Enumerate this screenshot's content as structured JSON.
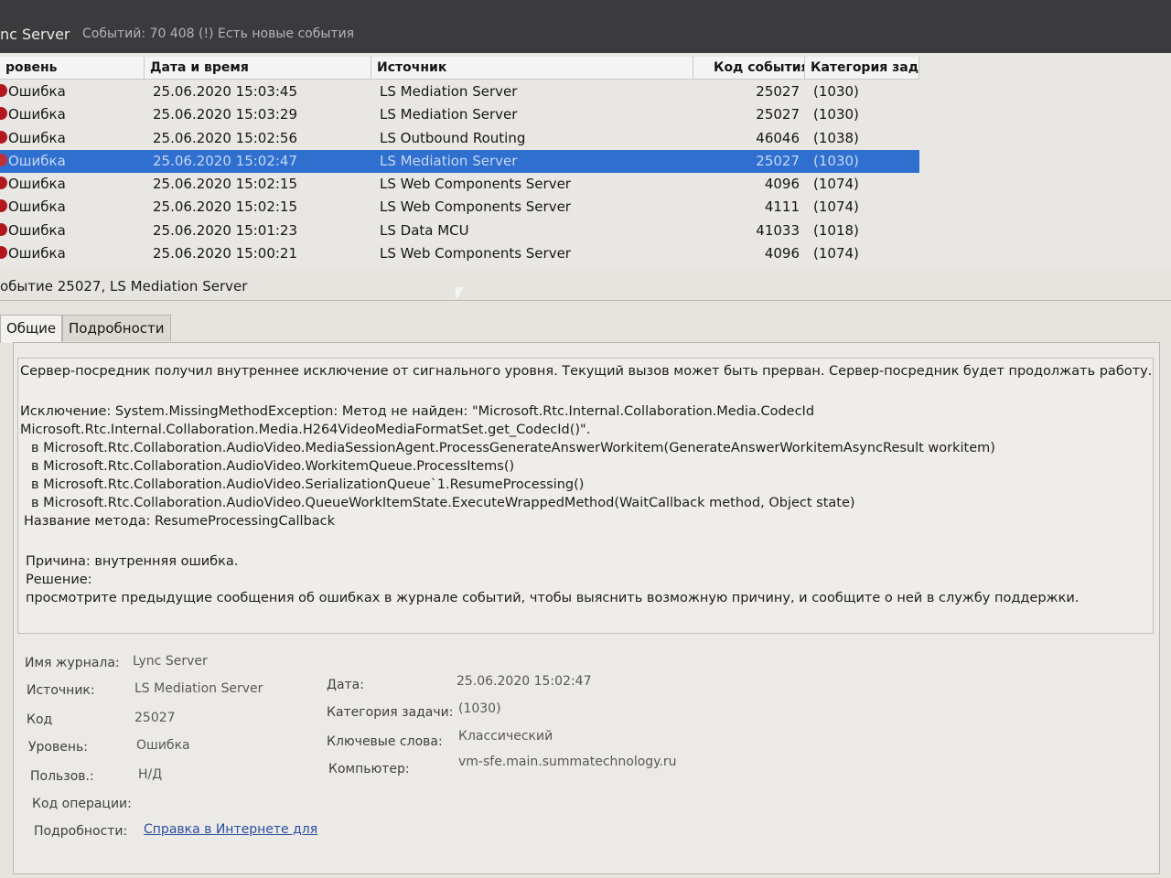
{
  "window": {
    "title": "nc Server",
    "status": "Событий: 70 408 (!) Есть новые события"
  },
  "columns": [
    "ровень",
    "Дата и время",
    "Источник",
    "Код события",
    "Категория зад..."
  ],
  "events": [
    {
      "level": "Ошибка",
      "datetime": "25.06.2020 15:03:45",
      "source": "LS Mediation Server",
      "code": "25027",
      "category": "(1030)",
      "selected": false
    },
    {
      "level": "Ошибка",
      "datetime": "25.06.2020 15:03:29",
      "source": "LS Mediation Server",
      "code": "25027",
      "category": "(1030)",
      "selected": false
    },
    {
      "level": "Ошибка",
      "datetime": "25.06.2020 15:02:56",
      "source": "LS Outbound Routing",
      "code": "46046",
      "category": "(1038)",
      "selected": false
    },
    {
      "level": "Ошибка",
      "datetime": "25.06.2020 15:02:47",
      "source": "LS Mediation Server",
      "code": "25027",
      "category": "(1030)",
      "selected": true
    },
    {
      "level": "Ошибка",
      "datetime": "25.06.2020 15:02:15",
      "source": "LS Web Components Server",
      "code": "4096",
      "category": "(1074)",
      "selected": false
    },
    {
      "level": "Ошибка",
      "datetime": "25.06.2020 15:02:15",
      "source": "LS Web Components Server",
      "code": "4111",
      "category": "(1074)",
      "selected": false
    },
    {
      "level": "Ошибка",
      "datetime": "25.06.2020 15:01:23",
      "source": "LS Data MCU",
      "code": "41033",
      "category": "(1018)",
      "selected": false
    },
    {
      "level": "Ошибка",
      "datetime": "25.06.2020 15:00:21",
      "source": "LS Web Components Server",
      "code": "4096",
      "category": "(1074)",
      "selected": false
    }
  ],
  "detail": {
    "title": "обытие 25027, LS Mediation Server",
    "tabs": [
      "Общие",
      "Подробности"
    ],
    "message": [
      "Сервер-посредник получил внутреннее исключение от сигнального уровня. Текущий вызов может быть прерван. Сервер-посредник будет продолжать работу.",
      "",
      "Исключение: System.MissingMethodException: Метод не найден: \"Microsoft.Rtc.Internal.Collaboration.Media.CodecId",
      "Microsoft.Rtc.Internal.Collaboration.Media.H264VideoMediaFormatSet.get_CodecId()\".",
      "  в Microsoft.Rtc.Collaboration.AudioVideo.MediaSessionAgent.ProcessGenerateAnswerWorkitem(GenerateAnswerWorkitemAsyncResult workitem)",
      "  в Microsoft.Rtc.Collaboration.AudioVideo.WorkitemQueue.ProcessItems()",
      "  в Microsoft.Rtc.Collaboration.AudioVideo.SerializationQueue`1.ResumeProcessing()",
      "  в Microsoft.Rtc.Collaboration.AudioVideo.QueueWorkItemState.ExecuteWrappedMethod(WaitCallback method, Object state)",
      "Название метода: ResumeProcessingCallback",
      "",
      "Причина: внутренняя ошибка.",
      "Решение:",
      "просмотрите предыдущие сообщения об ошибках в журнале событий, чтобы выяснить возможную причину, и сообщите о ней в службу поддержки."
    ],
    "props": {
      "log_label": "Имя журнала:",
      "log_value": "Lync Server",
      "source_label": "Источник:",
      "source_value": "LS Mediation Server",
      "date_label": "Дата:",
      "date_value": "25.06.2020 15:02:47",
      "code_label": "Код",
      "code_value": "25027",
      "category_label": "Категория задачи:",
      "category_value": "(1030)",
      "level_label": "Уровень:",
      "level_value": "Ошибка",
      "keywords_label": "Ключевые слова:",
      "keywords_value": "Классический",
      "user_label": "Пользов.:",
      "user_value": "Н/Д",
      "computer_label": "Компьютер:",
      "computer_value": "vm-sfe.main.summatechnology.ru",
      "opcode_label": "Код операции:",
      "more_label": "Подробности:",
      "more_link": "Справка в Интернете для"
    }
  }
}
